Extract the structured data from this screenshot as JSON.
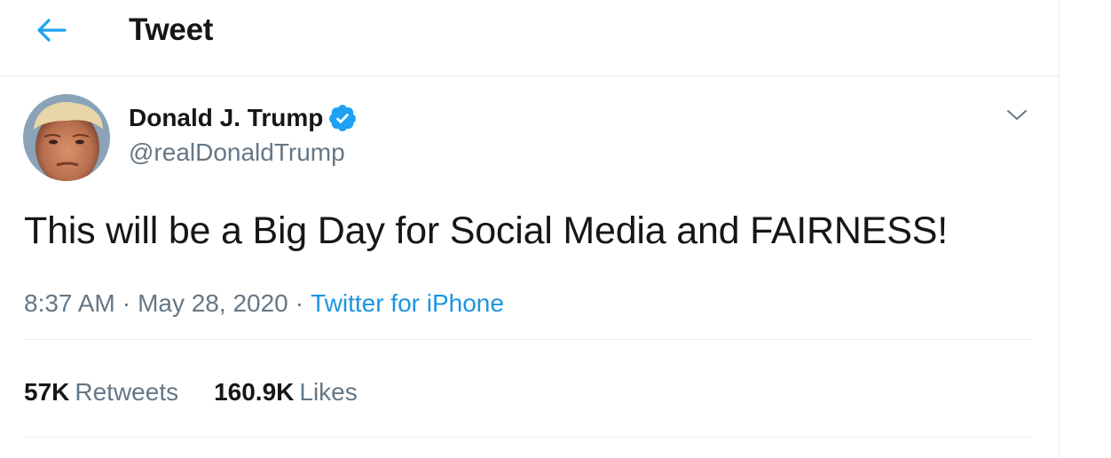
{
  "header": {
    "back_icon": "arrow-left-icon",
    "title": "Tweet"
  },
  "tweet": {
    "author": {
      "display_name": "Donald J. Trump",
      "handle": "@realDonaldTrump",
      "verified_icon": "verified-badge-icon"
    },
    "menu_icon": "chevron-down-icon",
    "text": "This will be a Big Day for Social Media and FAIRNESS!",
    "time": "8:37 AM",
    "date": "May 28, 2020",
    "separator": "·",
    "source": "Twitter for iPhone",
    "stats": {
      "retweets_count": "57K",
      "retweets_label": "Retweets",
      "likes_count": "160.9K",
      "likes_label": "Likes"
    }
  },
  "colors": {
    "accent": "#1da1f2",
    "link": "#1b95e0",
    "text": "#14171a",
    "muted": "#657786",
    "border": "#e6ecf0"
  }
}
